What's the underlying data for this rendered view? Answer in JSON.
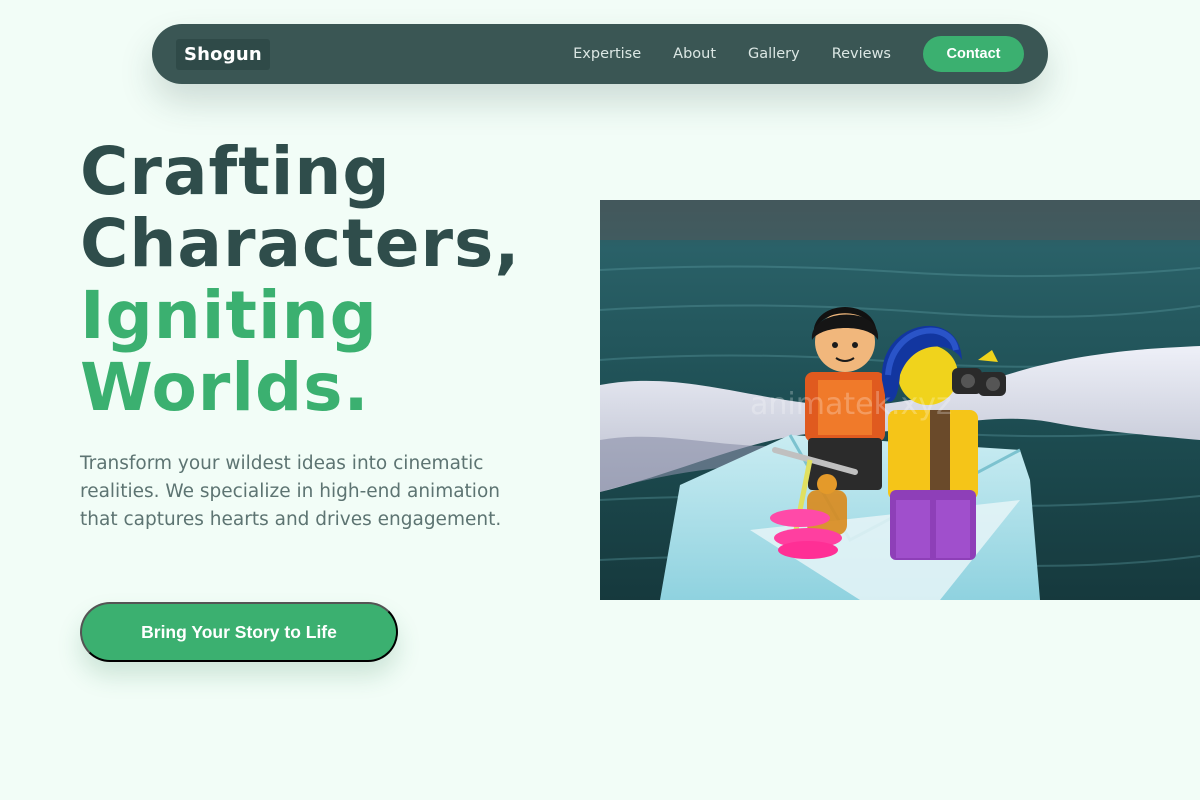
{
  "nav": {
    "logo": "Shogun",
    "links": [
      "Expertise",
      "About",
      "Gallery",
      "Reviews"
    ],
    "contact": "Contact"
  },
  "hero": {
    "title_line1": "Crafting",
    "title_line2": "Characters,",
    "title_line3": "Igniting",
    "title_line4": "Worlds.",
    "description": "Transform your wildest ideas into cinematic realities. We specialize in high-end animation that captures hearts and drives engagement.",
    "cta": "Bring Your Story to Life"
  },
  "image": {
    "watermark": "animatek.xyz"
  },
  "colors": {
    "accent": "#3bb070",
    "nav_bg": "#3a5654",
    "title_dark": "#2f4d4b",
    "page_bg": "#f2fdf7"
  }
}
